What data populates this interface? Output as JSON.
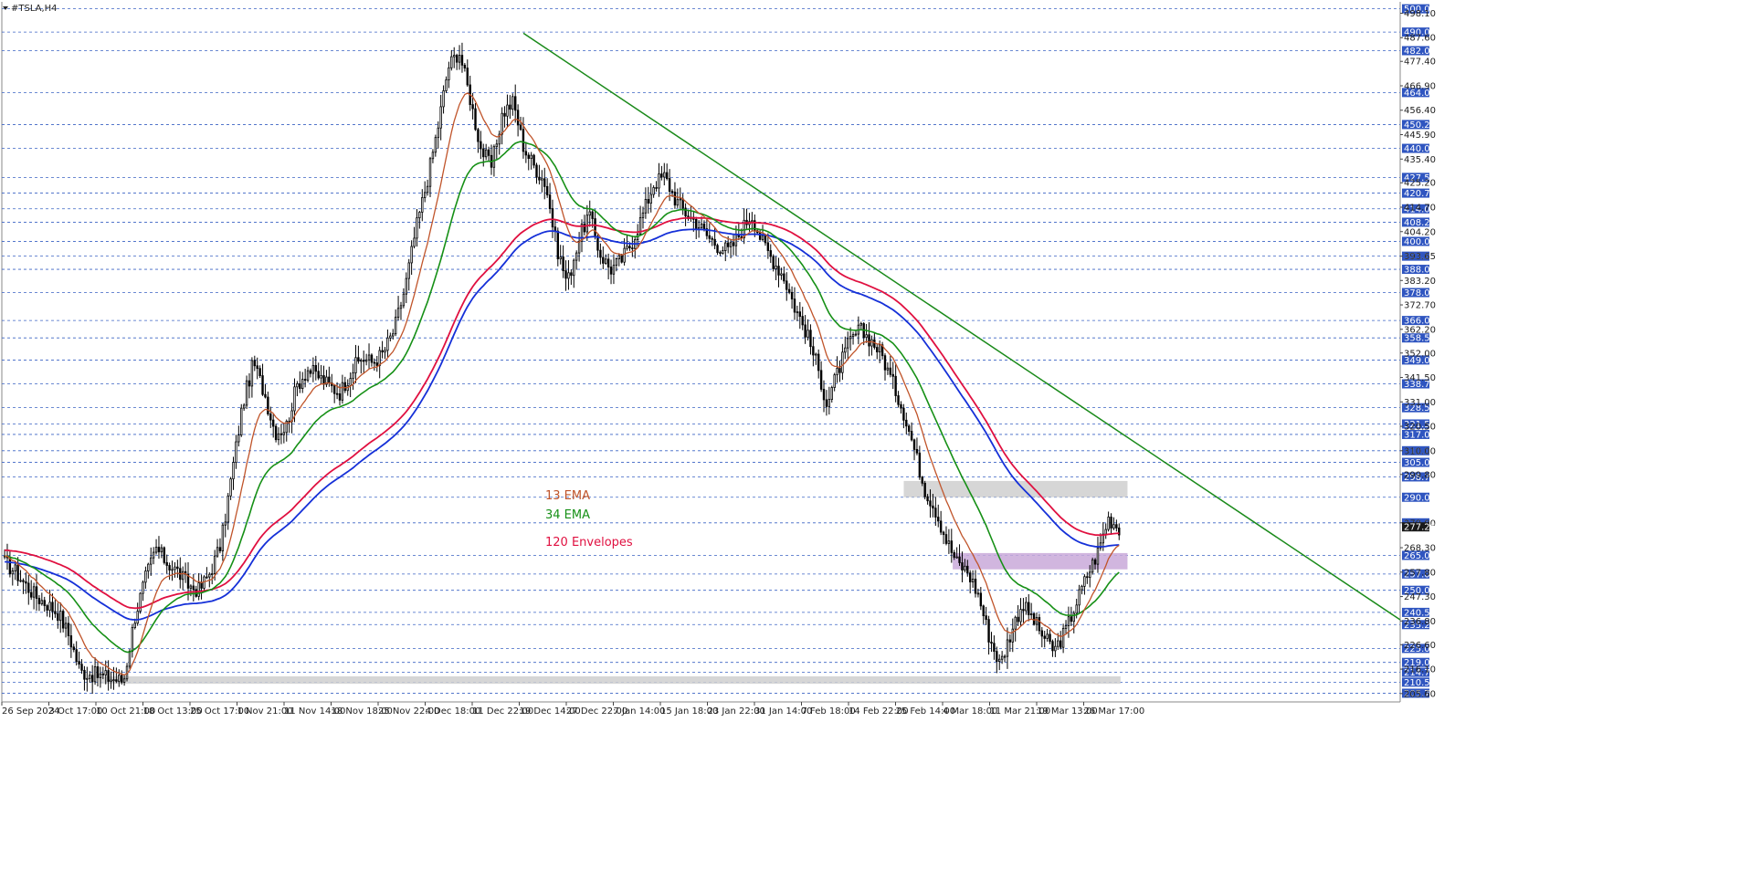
{
  "header": {
    "symbol": "#TSLA,H4"
  },
  "colors": {
    "background": "#ffffff",
    "grid": "#3b63c4",
    "axis_badge": "#2f55c0",
    "price_badge": "#1a1a1a",
    "candle": "#000000",
    "ema13": "#c0542a",
    "ema34": "#169016",
    "envelope_upper": "#e01040",
    "envelope_lower": "#1530d8",
    "trendline": "#1a8a1a",
    "zone_gray": "#cfcfcf",
    "zone_purple": "#c9a9d9"
  },
  "chart_data": {
    "type": "candlestick",
    "ylim": [
      202,
      503
    ],
    "price_levels": [
      "500.00",
      "490.00",
      "482.00",
      "464.00",
      "450.25",
      "440.00",
      "427.50",
      "420.75",
      "414.00",
      "408.25",
      "400.00",
      "393.65",
      "388.00",
      "378.00",
      "366.00",
      "358.50",
      "349.00",
      "338.75",
      "328.50",
      "321.50",
      "317.00",
      "310.00",
      "305.00",
      "298.75",
      "290.00",
      "279.00",
      "265.00",
      "257.00",
      "250.00",
      "240.50",
      "235.25",
      "225.00",
      "219.00",
      "214.75",
      "210.50",
      "205.75"
    ],
    "price_ticks": [
      "498.10",
      "487.60",
      "477.40",
      "466.90",
      "456.40",
      "445.90",
      "435.40",
      "425.20",
      "414.70",
      "404.20",
      "393.65",
      "383.20",
      "372.70",
      "362.20",
      "352.00",
      "341.50",
      "331.00",
      "320.50",
      "310.00",
      "299.80",
      "279.00",
      "268.30",
      "257.80",
      "247.30",
      "236.80",
      "226.60",
      "216.10",
      "205.60"
    ],
    "current_price": "277.26",
    "x_labels": [
      "26 Sep 2024",
      "3 Oct 17:00",
      "10 Oct 21:00",
      "18 Oct 13:00",
      "25 Oct 17:00",
      "1 Nov 21:00",
      "11 Nov 14:00",
      "18 Nov 18:00",
      "25 Nov 22:00",
      "4 Dec 18:00",
      "11 Dec 22:00",
      "19 Dec 14:00",
      "27 Dec 22:00",
      "7 Jan 14:00",
      "15 Jan 18:00",
      "23 Jan 22:00",
      "31 Jan 14:00",
      "7 Feb 18:00",
      "14 Feb 22:00",
      "25 Feb 14:00",
      "4 Mar 18:00",
      "11 Mar 21:00",
      "19 Mar 13:00",
      "26 Mar 17:00"
    ],
    "close_path": [
      262,
      258,
      252,
      247,
      244,
      240,
      230,
      215,
      214,
      213,
      212,
      211,
      238,
      255,
      268,
      262,
      258,
      252,
      250,
      258,
      270,
      300,
      330,
      348,
      335,
      318,
      320,
      338,
      345,
      342,
      338,
      335,
      344,
      350,
      348,
      352,
      362,
      380,
      405,
      425,
      448,
      475,
      482,
      462,
      440,
      432,
      455,
      460,
      440,
      432,
      425,
      398,
      382,
      400,
      412,
      395,
      388,
      392,
      400,
      412,
      425,
      428,
      418,
      412,
      408,
      402,
      398,
      396,
      404,
      412,
      400,
      392,
      385,
      372,
      362,
      348,
      330,
      344,
      356,
      362,
      358,
      352,
      340,
      328,
      312,
      294,
      285,
      272,
      262,
      258,
      248,
      230,
      218,
      232,
      244,
      238,
      230,
      224,
      232,
      244,
      256,
      266,
      281,
      277
    ],
    "series": [
      {
        "name": "13 EMA"
      },
      {
        "name": "34 EMA"
      },
      {
        "name": "120 Envelopes"
      }
    ],
    "zones": [
      {
        "color": "gray",
        "top": 297,
        "bottom": 290,
        "from": 0.645,
        "to": 0.805
      },
      {
        "color": "purple",
        "top": 266,
        "bottom": 259,
        "from": 0.68,
        "to": 0.805
      },
      {
        "color": "gray",
        "top": 213,
        "bottom": 209.8,
        "from": 0.07,
        "to": 0.8
      }
    ],
    "trendline": {
      "from": [
        0.373,
        489.5
      ],
      "to": [
        1.0,
        237.3
      ]
    },
    "annotations": [
      {
        "text": "13 EMA",
        "color": "ema13"
      },
      {
        "text": "34 EMA",
        "color": "ema34"
      },
      {
        "text": "120 Envelopes",
        "color": "envelope_upper"
      }
    ]
  }
}
